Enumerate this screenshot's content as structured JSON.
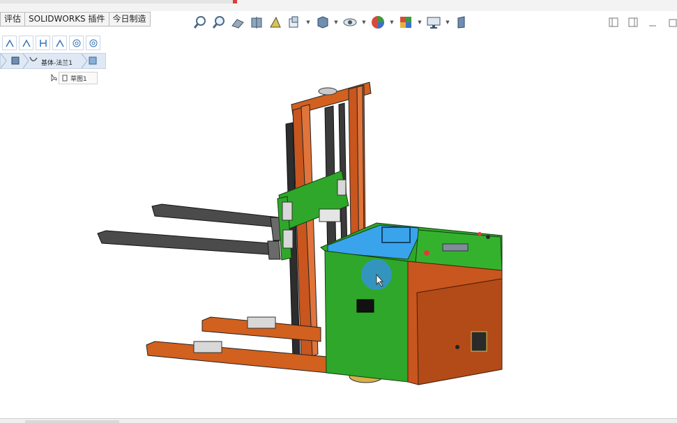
{
  "tabs": [
    {
      "label": "评估"
    },
    {
      "label": "SOLIDWORKS 插件"
    },
    {
      "label": "今日制造"
    }
  ],
  "toolbar": {
    "icons": [
      "zoom-to-fit-icon",
      "zoom-area-icon",
      "previous-view-icon",
      "section-view-icon",
      "dynamic-annotation-icon",
      "view-orientation-icon",
      "display-style-icon",
      "hide-show-icon",
      "edit-appearance-icon",
      "apply-scene-icon",
      "view-settings-icon",
      "display-pane-icon"
    ]
  },
  "breadcrumb": {
    "feature_label": "基体-法兰1"
  },
  "sketch_item": {
    "label": "草图1"
  },
  "accent": "#3492d8",
  "model": {
    "colors": {
      "body_green": "#2fa72a",
      "body_orange": "#c8561e",
      "top_blue": "#39a4ec",
      "fork_gray": "#4a4a4a",
      "mast_orange": "#d2601e"
    }
  }
}
